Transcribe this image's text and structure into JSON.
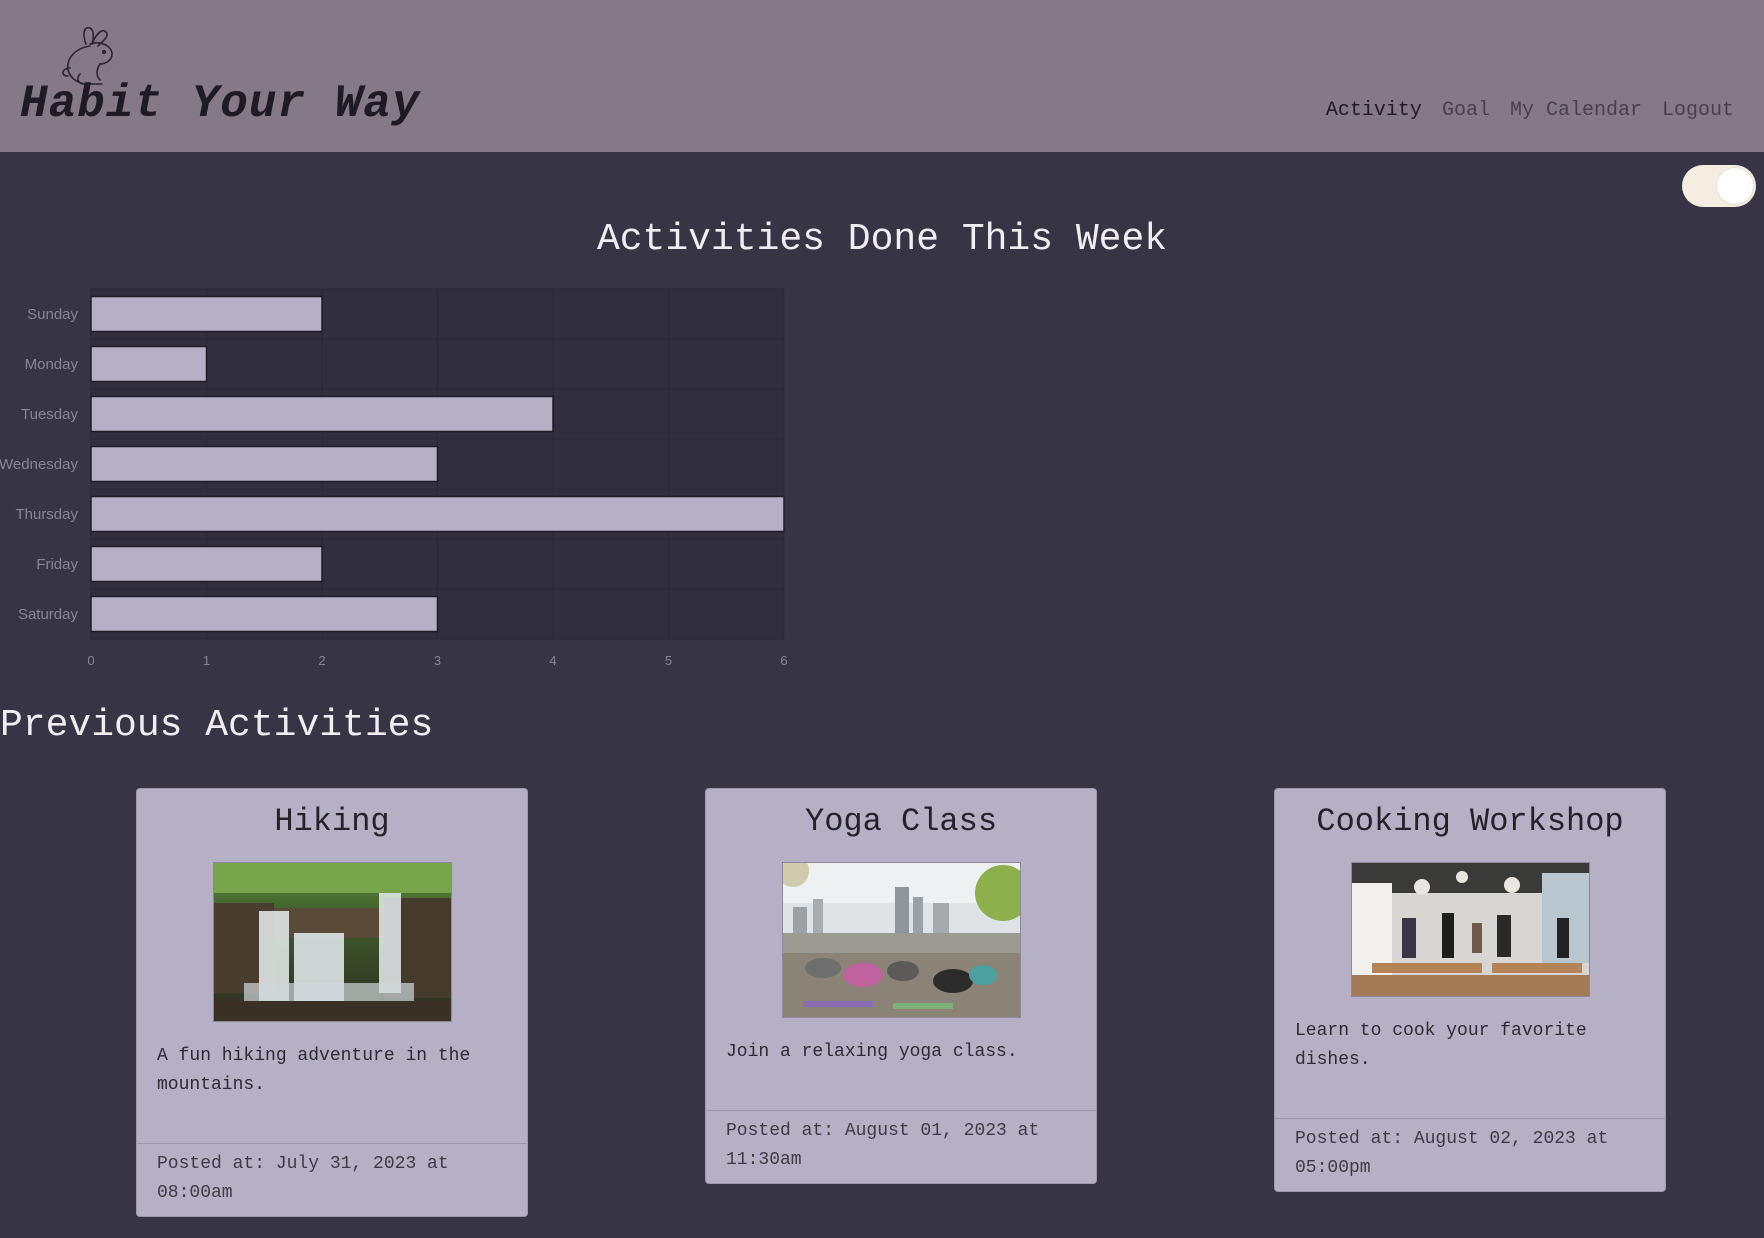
{
  "header": {
    "brand": "Habit Your Way",
    "nav": [
      {
        "label": "Activity",
        "active": true
      },
      {
        "label": "Goal",
        "active": false
      },
      {
        "label": "My Calendar",
        "active": false
      },
      {
        "label": "Logout",
        "active": false
      }
    ]
  },
  "theme_toggle": {
    "on": true
  },
  "chart_section": {
    "title": "Activities Done This Week"
  },
  "chart_data": {
    "type": "bar",
    "orientation": "horizontal",
    "categories": [
      "Sunday",
      "Monday",
      "Tuesday",
      "Wednesday",
      "Thursday",
      "Friday",
      "Saturday"
    ],
    "values": [
      2,
      1,
      4,
      3,
      6,
      2,
      3
    ],
    "xticks": [
      "0",
      "1",
      "2",
      "3",
      "4",
      "5",
      "6"
    ],
    "xlim": [
      0,
      6
    ],
    "grid": true,
    "bar_color": "#b5b0c6",
    "bar_edge_color": "#1f1c27",
    "grid_color": "#2b2838",
    "tick_label_color": "#8a8598",
    "plot_background": "#312e3f"
  },
  "previous": {
    "title": "Previous Activities",
    "cards": [
      {
        "title": "Hiking",
        "image": "waterfall-photo",
        "description": "A fun hiking adventure in the mountains.",
        "posted": "Posted at: July 31, 2023 at 08:00am"
      },
      {
        "title": "Yoga Class",
        "image": "yoga-rooftop-photo",
        "description": "Join a relaxing yoga class.",
        "posted": "Posted at: August 01, 2023 at 11:30am"
      },
      {
        "title": "Cooking Workshop",
        "image": "kitchen-workshop-photo",
        "description": "Learn to cook your favorite dishes.",
        "posted": "Posted at: August 02, 2023 at 05:00pm"
      }
    ]
  },
  "colors": {
    "header_bg": "#857987",
    "page_bg": "#373446",
    "card_bg": "#b5b0c6",
    "toggle_bg": "#f3eedf"
  }
}
